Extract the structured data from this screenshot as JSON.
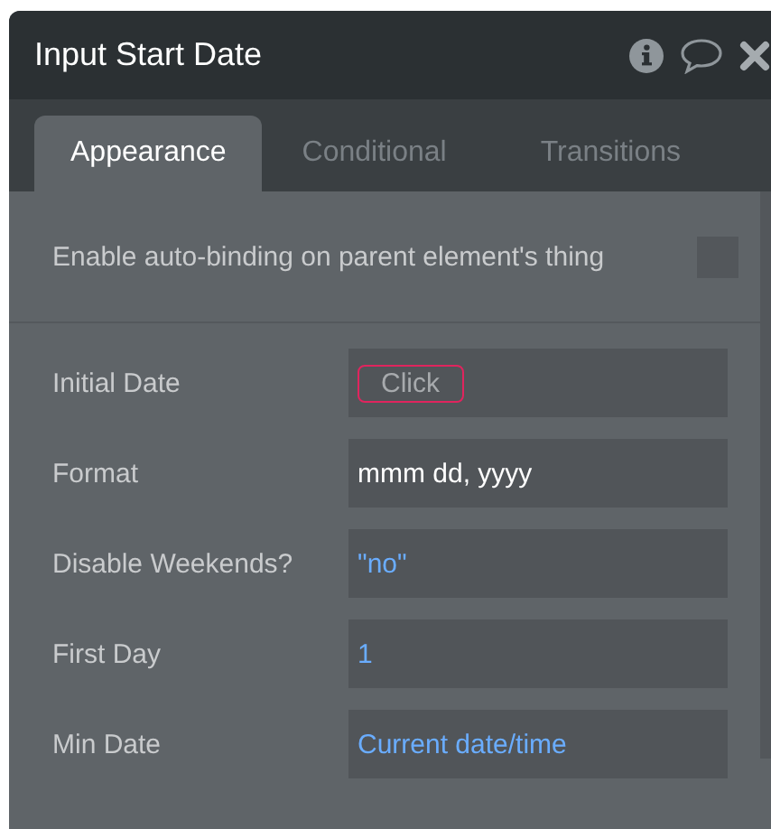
{
  "window": {
    "title": "Input Start Date"
  },
  "tabs": [
    {
      "label": "Appearance",
      "selected": true
    },
    {
      "label": "Conditional",
      "selected": false
    },
    {
      "label": "Transitions",
      "selected": false
    }
  ],
  "auto_binding": {
    "label": "Enable auto-binding on parent element's thing",
    "checked": false
  },
  "properties": [
    {
      "label": "Initial Date",
      "kind": "button",
      "value": "Click"
    },
    {
      "label": "Format",
      "kind": "text",
      "value": "mmm dd, yyyy"
    },
    {
      "label": "Disable Weekends?",
      "kind": "dynamic",
      "value": "\"no\""
    },
    {
      "label": "First Day",
      "kind": "dynamic",
      "value": "1"
    },
    {
      "label": "Min Date",
      "kind": "dynamic",
      "value": "Current date/time"
    }
  ]
}
